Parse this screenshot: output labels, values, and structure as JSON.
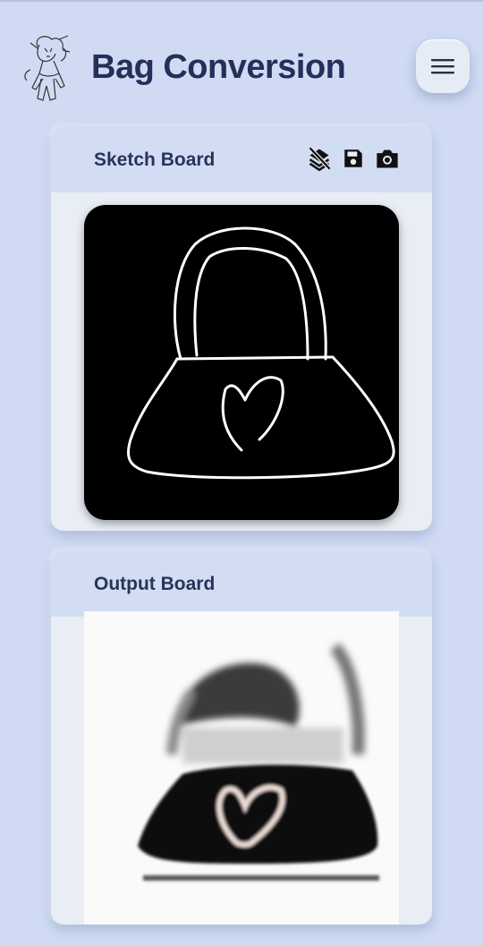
{
  "header": {
    "title": "Bag Conversion",
    "logo_icon": "sketch-character-logo-icon",
    "menu_icon": "hamburger-menu-icon"
  },
  "sketch_board": {
    "title": "Sketch Board",
    "tools": [
      "clear-layers-icon",
      "save-icon",
      "camera-icon"
    ]
  },
  "output_board": {
    "title": "Output Board"
  },
  "colors": {
    "background": "#d0dbf3",
    "card": "#e9eef5",
    "card_header": "#d2ddf4",
    "title_text": "#22305a",
    "canvas": "#000000"
  }
}
